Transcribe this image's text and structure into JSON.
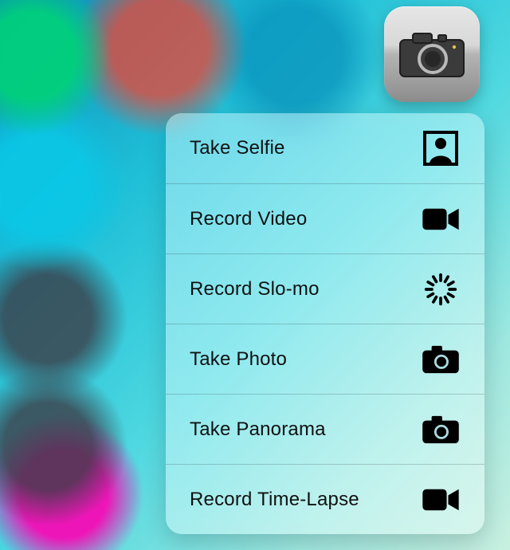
{
  "app": {
    "name": "Camera",
    "icon": "camera-icon"
  },
  "menu": {
    "items": [
      {
        "label": "Take Selfie",
        "icon": "selfie-icon"
      },
      {
        "label": "Record Video",
        "icon": "video-icon"
      },
      {
        "label": "Record Slo-mo",
        "icon": "slomo-icon"
      },
      {
        "label": "Take Photo",
        "icon": "camera-icon-sm"
      },
      {
        "label": "Take Panorama",
        "icon": "camera-icon-sm"
      },
      {
        "label": "Record Time-Lapse",
        "icon": "video-icon"
      }
    ]
  },
  "colors": {
    "text": "#111111",
    "divider": "rgba(0,0,0,0.18)"
  }
}
